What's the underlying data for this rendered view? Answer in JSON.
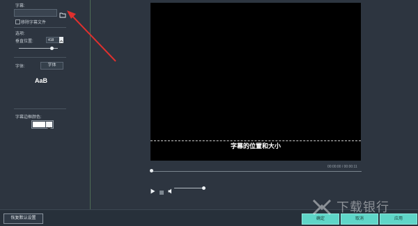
{
  "sidebar": {
    "subtitle_label": "字幕:",
    "subtitle_path_value": "",
    "remove_subtitle_label": "移除字幕文件",
    "options_label": "选项:",
    "vertical_position_label": "垂直位置:",
    "vertical_position_value": "418",
    "vertical_position_fraction": 0.85,
    "font_label": "字体:",
    "font_button": "字体",
    "font_preview": "AaB",
    "border_color_label": "字幕边框颜色:",
    "border_color": "#ffffff"
  },
  "preview": {
    "subtitle_text": "字幕的位置和大小",
    "time": "00:00:00 / 00:00:11",
    "progress_fraction": 0.0,
    "volume_fraction": 1.0
  },
  "footer": {
    "reset_button": "恢复默认设置",
    "ok_button": "确定",
    "cancel_button": "取消",
    "apply_button": "应用"
  },
  "watermark": {
    "text": "下载银行"
  },
  "colors": {
    "accent": "#5fd6c8",
    "arrow": "#e0302e"
  }
}
